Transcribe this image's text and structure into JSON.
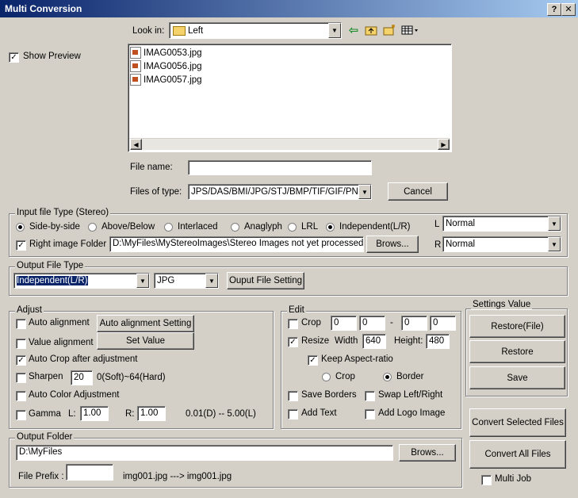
{
  "window": {
    "title": "Multi Conversion",
    "help_glyph": "?",
    "close_glyph": "✕"
  },
  "dialog": {
    "look_in_label": "Look in:",
    "look_in_value": "Left",
    "show_preview_label": "Show Preview",
    "show_preview_checked": true,
    "files": [
      "IMAG0053.jpg",
      "IMAG0056.jpg",
      "IMAG0057.jpg"
    ],
    "file_name_label": "File name:",
    "file_name_value": "",
    "files_of_type_label": "Files of type:",
    "files_of_type_value": "JPS/DAS/BMI/JPG/STJ/BMP/TIF/GIF/PN",
    "cancel_label": "Cancel"
  },
  "input_type": {
    "group_label": "Input file Type (Stereo)",
    "options": [
      "Side-by-side",
      "Above/Below",
      "Interlaced",
      "Anaglyph",
      "LRL",
      "Independent(L/R)"
    ],
    "selected": [
      "Side-by-side",
      "Independent(L/R)"
    ],
    "right_folder_label": "Right image Folder :",
    "right_folder_checked": true,
    "right_folder_path": "D:\\MyFiles\\MyStereoImages\\Stereo Images not yet processed\\Rig",
    "browse_label": "Brows...",
    "l_label": "L",
    "l_value": "Normal",
    "r_label": "R",
    "r_value": "Normal"
  },
  "output_type": {
    "group_label": "Output File Type",
    "type_value": "Independent(L/R)",
    "format_value": "JPG",
    "setting_button": "Ouput File Setting"
  },
  "adjust": {
    "group_label": "Adjust",
    "auto_alignment": "Auto alignment",
    "auto_alignment_setting": "Auto alignment Setting",
    "value_alignment": "Value alignment",
    "set_value": "Set Value",
    "auto_crop": "Auto Crop after adjustment",
    "auto_crop_checked": true,
    "sharpen": "Sharpen",
    "sharpen_value": "20",
    "sharpen_range": "0(Soft)~64(Hard)",
    "auto_color": "Auto Color Adjustment",
    "gamma": "Gamma",
    "gamma_l_label": "L:",
    "gamma_l": "1.00",
    "gamma_r_label": "R:",
    "gamma_r": "1.00",
    "gamma_range": "0.01(D) -- 5.00(L)"
  },
  "edit": {
    "group_label": "Edit",
    "crop": "Crop",
    "crop_values": [
      "0",
      "0",
      "0",
      "0"
    ],
    "crop_dash": "-",
    "resize": "Resize",
    "resize_checked": true,
    "width_label": "Width",
    "width_value": "640",
    "height_label": "Height:",
    "height_value": "480",
    "keep_aspect": "Keep Aspect-ratio",
    "keep_aspect_checked": true,
    "crop_radio": "Crop",
    "border_radio": "Border",
    "save_borders": "Save Borders",
    "swap_lr": "Swap Left/Right",
    "add_text": "Add Text",
    "add_logo": "Add Logo Image"
  },
  "settings": {
    "group_label": "Settings Value",
    "restore_file": "Restore(File)",
    "restore": "Restore",
    "save": "Save"
  },
  "actions": {
    "convert_selected": "Convert Selected Files",
    "convert_all": "Convert All Files",
    "multi_job": "Multi Job"
  },
  "output_folder": {
    "group_label": "Output Folder",
    "path": "D:\\MyFiles",
    "browse_label": "Brows...",
    "prefix_label": "File Prefix :",
    "prefix_value": "",
    "example": "img001.jpg ---> img001.jpg"
  }
}
